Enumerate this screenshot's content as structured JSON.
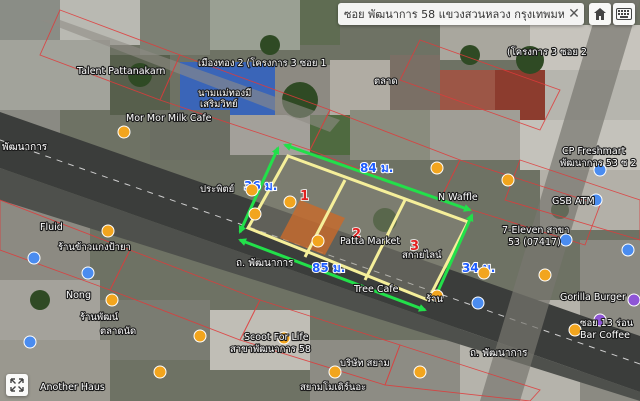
{
  "search": {
    "value": "ซอย พัฒนาการ 58 แขวงสวนหลวง กรุงเทพมหานคร"
  },
  "controls": {
    "close_icon": "close-icon",
    "home_icon": "home-icon",
    "keyboard_icon": "keyboard-icon",
    "expand_icon": "expand-icon"
  },
  "colors": {
    "outline": "#f5ef9a",
    "arrow": "#22e04a",
    "measure": "#1e5cff",
    "lot_number": "#e02020",
    "poi": "#f2a51e",
    "boundary": "#e03a3a"
  },
  "labels": {
    "talent": "Talent Pattanakarn",
    "soi_top_left": "เมืองทอง 2 (โครงการ 3 ซอย 1",
    "soi_top_right": "(โครงการ 3 ซอย 2",
    "shop_left": "นามแม่ทองมี",
    "shop_left2": "เสริมวิทย์",
    "market_top": "ตลาด",
    "mormor": "Mor Mor Milk Cafe",
    "cp_fresh": "CP Freshmart",
    "cp_fresh2": "พัฒนาการ 53 ซ 2",
    "gsb": "GSB ATM",
    "n_waffle": "N Waffle",
    "seven": "7-Eleven สาขา",
    "seven2": "53 (07417)",
    "gorilla": "Gorilla Burger",
    "bar_coffee": "Bar Coffee",
    "soi13": "ซอย 13 ร่อน",
    "patta_market": "Patta Market",
    "tree_cafe": "Tree Cafe",
    "scoot": "Scoot For Life",
    "scoot2": "สาขาพัฒนาการ 58",
    "another": "Another Haus",
    "nong": "Nong",
    "road_left": "ถ. พัฒนาการ",
    "road_right": "ถ. พัฒนาการ",
    "road_far_left": "พัฒนาการ",
    "prachachuen": "ประพิตย์",
    "store_a": "ร้านข้าวแกงป้ายา",
    "store_b": "ร้านพัฒน์",
    "store_c": "ตลาดนัด",
    "lot_a": "สกายไลน์",
    "bottom_mid": "บริษัท สยาม",
    "bottom_mid2": "สยามโมเดิร์นอะ",
    "rotten": "ร้าน",
    "fluid": "Fluid"
  },
  "measures": {
    "m_top": "84 ม.",
    "m_bottom": "85 ม.",
    "m_left": "36 ม.",
    "m_right": "34 ม."
  },
  "lots": {
    "lot1": "1",
    "lot2": "2",
    "lot3": "3"
  }
}
